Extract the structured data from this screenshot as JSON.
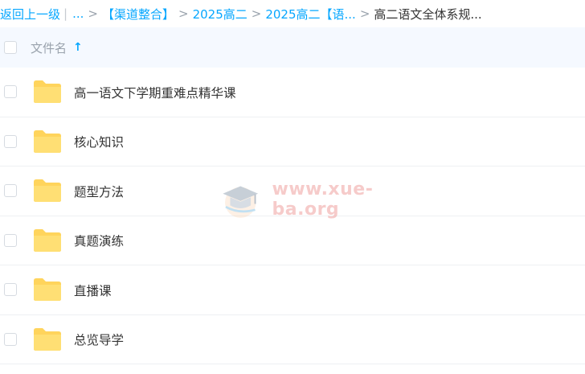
{
  "breadcrumb": {
    "back_label": "返回上一级",
    "ellipsis": "...",
    "crumbs": [
      "【渠道整合】",
      "2025高二",
      "2025高二【语...",
      "高二语文全体系规..."
    ]
  },
  "header": {
    "column_label": "文件名",
    "sort_icon": "arrow-up-icon"
  },
  "files": [
    {
      "name": "高一语文下学期重难点精华课",
      "icon": "folder-icon"
    },
    {
      "name": "核心知识",
      "icon": "folder-icon"
    },
    {
      "name": "题型方法",
      "icon": "folder-icon"
    },
    {
      "name": "真题演练",
      "icon": "folder-icon"
    },
    {
      "name": "直播课",
      "icon": "folder-icon"
    },
    {
      "name": "总览导学",
      "icon": "folder-icon"
    }
  ],
  "watermark": {
    "text": "www.xue-ba.org"
  },
  "colors": {
    "accent": "#06a7ff",
    "folder": "#ffd45c",
    "header_bg": "#f5f9ff"
  }
}
